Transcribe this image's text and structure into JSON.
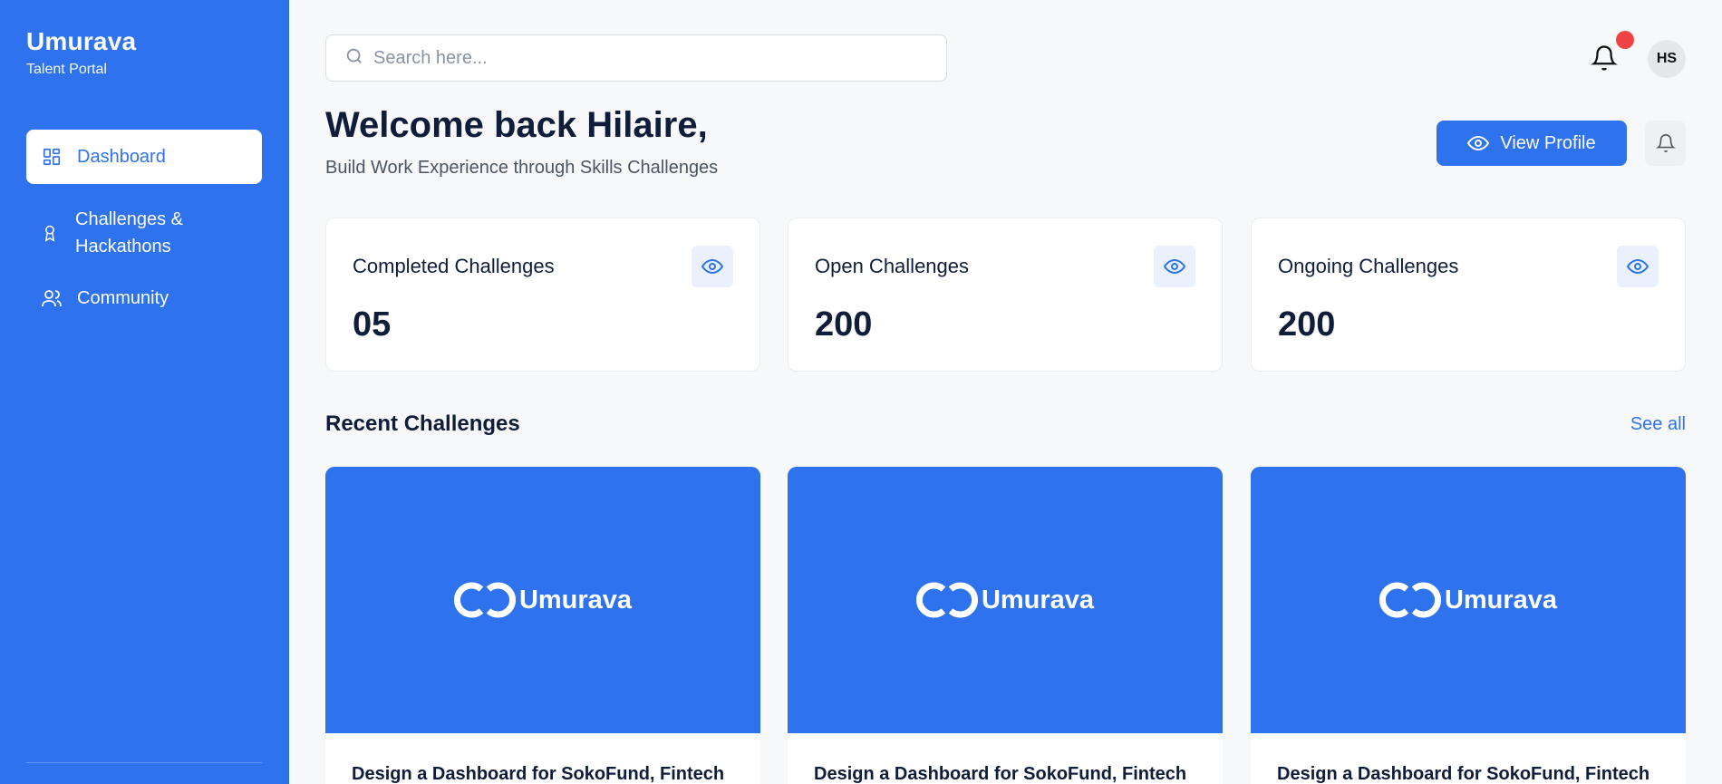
{
  "brand": {
    "title": "Umurava",
    "subtitle": "Talent Portal"
  },
  "sidebar": {
    "items": [
      {
        "label": "Dashboard",
        "icon": "dashboard-icon",
        "active": true
      },
      {
        "label": "Challenges & Hackathons",
        "icon": "award-icon",
        "active": false
      },
      {
        "label": "Community",
        "icon": "users-icon",
        "active": false
      }
    ]
  },
  "search": {
    "placeholder": "Search here..."
  },
  "user": {
    "initials": "HS"
  },
  "header": {
    "welcome": "Welcome back Hilaire,",
    "subtitle": "Build Work Experience through Skills Challenges",
    "view_profile_label": "View Profile"
  },
  "stats": [
    {
      "label": "Completed Challenges",
      "value": "05"
    },
    {
      "label": "Open Challenges",
      "value": "200"
    },
    {
      "label": "Ongoing Challenges",
      "value": "200"
    }
  ],
  "recent": {
    "title": "Recent Challenges",
    "see_all": "See all",
    "cards": [
      {
        "logo_text": "Umurava",
        "title": "Design a Dashboard for SokoFund, Fintech"
      },
      {
        "logo_text": "Umurava",
        "title": "Design a Dashboard for SokoFund, Fintech"
      },
      {
        "logo_text": "Umurava",
        "title": "Design a Dashboard for SokoFund, Fintech"
      }
    ]
  },
  "colors": {
    "primary": "#2f72ee",
    "notification": "#ef4444",
    "text_dark": "#0f1d3a"
  }
}
